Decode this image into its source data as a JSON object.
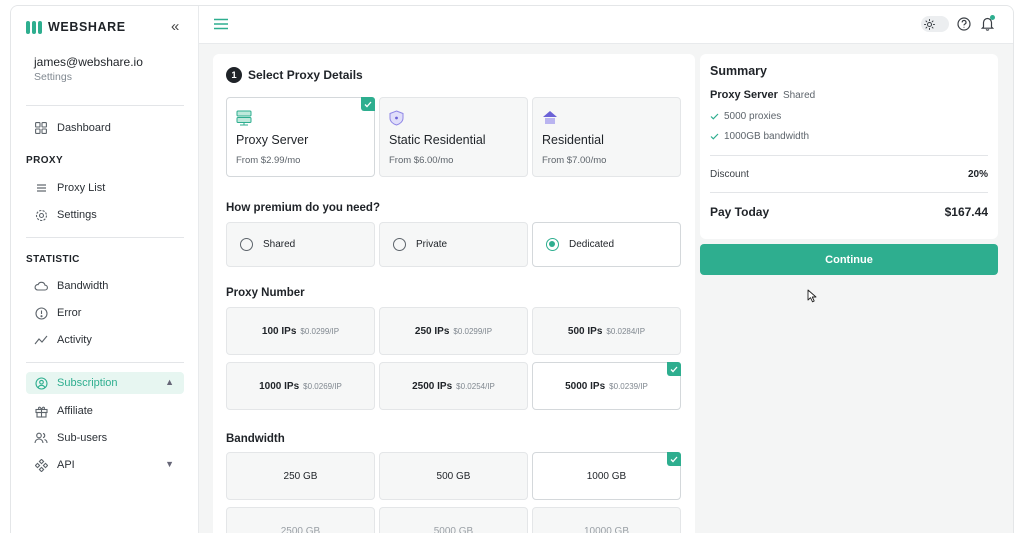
{
  "brand": {
    "name": "WEBSHARE"
  },
  "user": {
    "email": "james@webshare.io",
    "sub": "Settings"
  },
  "nav": {
    "dashboard": "Dashboard",
    "proxy_section": "PROXY",
    "proxy_list": "Proxy List",
    "settings": "Settings",
    "statistic_section": "STATISTIC",
    "bandwidth": "Bandwidth",
    "error": "Error",
    "activity": "Activity",
    "subscription": "Subscription",
    "affiliate": "Affiliate",
    "sub_users": "Sub-users",
    "api": "API"
  },
  "step": {
    "number": "1",
    "title": "Select Proxy Details"
  },
  "proxy_types": [
    {
      "name": "Proxy Server",
      "price": "From $2.99/mo",
      "icon": "server-icon",
      "selected": true
    },
    {
      "name": "Static Residential",
      "price": "From $6.00/mo",
      "icon": "shield-icon",
      "selected": false
    },
    {
      "name": "Residential",
      "price": "From $7.00/mo",
      "icon": "home-icon",
      "selected": false
    }
  ],
  "premium": {
    "label": "How premium do you need?",
    "options": [
      {
        "name": "Shared",
        "selected": false
      },
      {
        "name": "Private",
        "selected": false
      },
      {
        "name": "Dedicated",
        "selected": true
      }
    ]
  },
  "proxy_number": {
    "label": "Proxy Number",
    "options": [
      {
        "count": "100 IPs",
        "price": "$0.0299/IP"
      },
      {
        "count": "250 IPs",
        "price": "$0.0299/IP"
      },
      {
        "count": "500 IPs",
        "price": "$0.0284/IP"
      },
      {
        "count": "1000 IPs",
        "price": "$0.0269/IP"
      },
      {
        "count": "2500 IPs",
        "price": "$0.0254/IP"
      },
      {
        "count": "5000 IPs",
        "price": "$0.0239/IP"
      }
    ]
  },
  "bandwidth": {
    "label": "Bandwidth",
    "options": [
      "250 GB",
      "500 GB",
      "1000 GB",
      "2500 GB",
      "5000 GB",
      "10000 GB"
    ]
  },
  "summary": {
    "title": "Summary",
    "product": "Proxy Server",
    "product_type": "Shared",
    "features": [
      "5000 proxies",
      "1000GB bandwidth"
    ],
    "discount_label": "Discount",
    "discount_value": "20%",
    "pay_label": "Pay Today",
    "pay_value": "$167.44",
    "continue_label": "Continue"
  },
  "colors": {
    "accent": "#2eae8f",
    "text": "#1f2328",
    "muted": "#5d646b"
  }
}
